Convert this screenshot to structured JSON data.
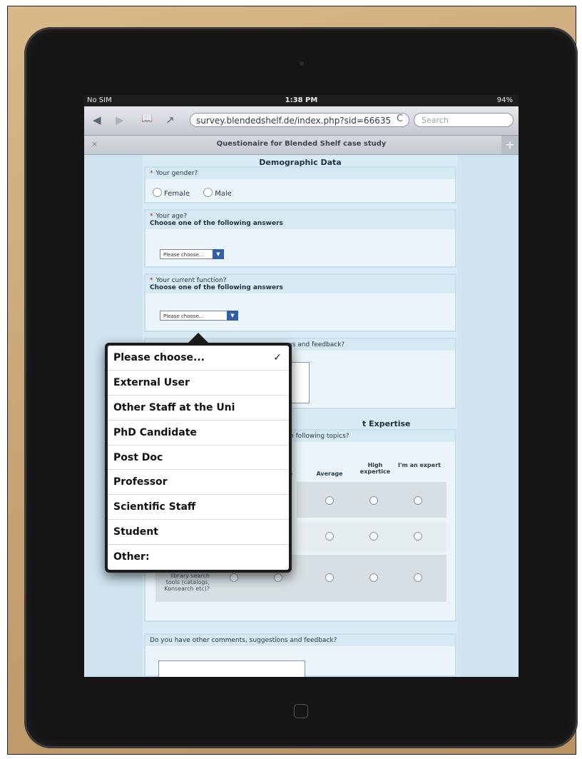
{
  "status": {
    "carrier": "No SIM",
    "time": "1:38 PM",
    "battery": "94%"
  },
  "browser": {
    "url": "survey.blendedshelf.de/index.php?sid=66635",
    "search_placeholder": "Search",
    "tab_title": "Questionaire for Blended Shelf case study",
    "tab_close": "×",
    "tab_add": "+",
    "back_icon": "◀",
    "forward_icon": "▶",
    "bookmarks_icon": "📖",
    "share_icon": "↗",
    "reload_icon": "C"
  },
  "survey": {
    "section1_title": "Demographic Data",
    "q_gender": "Your gender?",
    "gender_female": "Female",
    "gender_male": "Male",
    "q_age": "Your age?",
    "choose_hint": "Choose one of the following answers",
    "select_placeholder": "Please choose...",
    "q_function": "Your current function?",
    "q_comments_partial": "ns and feedback?",
    "section2_title_partial": "t Expertise",
    "expertise_q_partial": "h following topics?",
    "col_partial": "se",
    "col_average": "Average",
    "col_high": "High expertice",
    "col_expert": "I'm an expert",
    "row3_label": "Experience with library search tools (catalogs, Konsearch etc)?",
    "q_comments": "Do you have other comments, suggestions and feedback?"
  },
  "dropdown": {
    "options": [
      "Please choose...",
      "External User",
      "Other Staff at the Uni",
      "PhD Candidate",
      "Post Doc",
      "Professor",
      "Scientific Staff",
      "Student",
      "Other:"
    ],
    "selected_mark": "✓"
  }
}
